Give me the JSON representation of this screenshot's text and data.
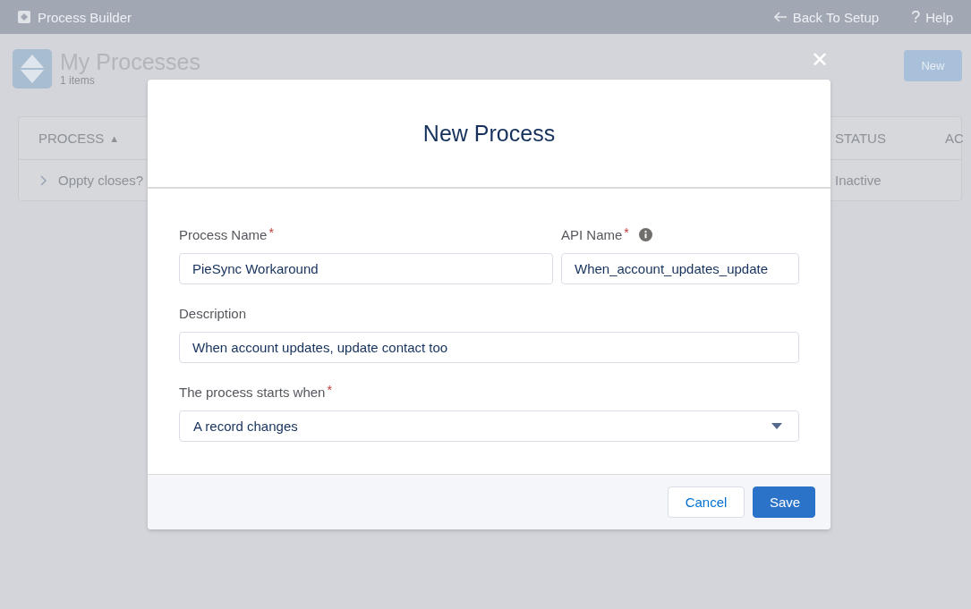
{
  "app_bar": {
    "title": "Process Builder",
    "back_link": "Back To Setup",
    "help_link": "Help",
    "help_glyph": "?"
  },
  "page": {
    "title": "My Processes",
    "count": "1 items",
    "new_button": "New"
  },
  "table": {
    "columns": [
      {
        "label": "PROCESS",
        "sort_glyph": "▲"
      },
      {
        "label": "STATUS"
      },
      {
        "label": "AC"
      }
    ],
    "rows": [
      {
        "name": "Oppty closes?",
        "status": "Inactive"
      }
    ]
  },
  "modal": {
    "close_glyph": "✕",
    "title": "New Process",
    "fields": [
      {
        "kind": "text",
        "label": "Process Name",
        "required_mark": "*",
        "value": "PieSync Workaround"
      },
      {
        "kind": "text",
        "label": "API Name",
        "required_mark": "*",
        "info": true,
        "value": "When_account_updates_update"
      },
      {
        "kind": "text",
        "label": "Description",
        "value": "When account updates, update contact too"
      },
      {
        "kind": "select",
        "label": "The process starts when",
        "required_mark": "*",
        "value": "A record changes"
      }
    ],
    "buttons": [
      {
        "label": "Cancel",
        "kind": "neutral"
      },
      {
        "label": "Save",
        "kind": "brand"
      }
    ]
  }
}
